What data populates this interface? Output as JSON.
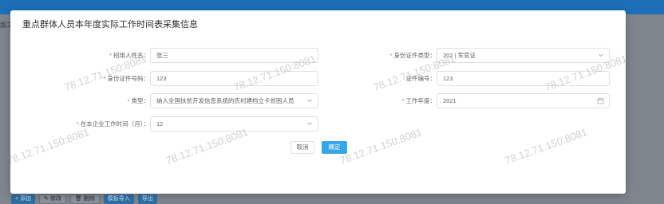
{
  "background": {
    "tab_label": "版工作",
    "toolbar": [
      "+ 添加",
      "✎ 修改",
      "🗑 删除",
      "模板导入",
      "导出"
    ]
  },
  "modal": {
    "title": "重点群体人员本年度实际工作时间表采集信息",
    "fields": {
      "name": {
        "label": "招用人姓名：",
        "value": "张三",
        "required": true
      },
      "id_type": {
        "label": "身份证件类型：",
        "value": "202 | 军官证",
        "required": true
      },
      "id_number": {
        "label": "身份证件号码：",
        "value": "123",
        "required": true
      },
      "cert_number": {
        "label": "证件编号：",
        "value": "123",
        "required": false
      },
      "category": {
        "label": "类型：",
        "value": "纳入全国扶贫开发信息系统的农村建档立卡贫困人员",
        "required": true
      },
      "work_year": {
        "label": "工作年度：",
        "value": "2021",
        "required": true
      },
      "months": {
        "label": "在本企业工作时间（月）：",
        "value": "12",
        "required": true
      }
    },
    "buttons": {
      "cancel": "取消",
      "ok": "确定"
    }
  },
  "watermark": "78.12.71.150:8081"
}
